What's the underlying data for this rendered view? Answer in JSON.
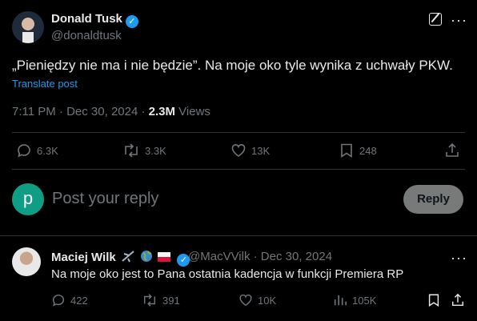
{
  "tweet": {
    "author_name": "Donald Tusk",
    "author_handle": "@donaldtusk",
    "text": "„Pieniędzy nie ma i nie będzie”. Na moje oko tyle wynika z uchwały PKW.",
    "translate_label": "Translate post",
    "time": "7:11 PM · Dec 30, 2024 · ",
    "views_count": "2.3M",
    "views_label": " Views",
    "replies": "6.3K",
    "reposts": "3.3K",
    "likes": "13K",
    "bookmarks": "248"
  },
  "composer": {
    "avatar_letter": "p",
    "placeholder": "Post your reply",
    "reply_button": "Reply"
  },
  "comment": {
    "author_name": "Maciej Wilk",
    "author_handle": "@MacVVilk",
    "date": " · Dec 30, 2024",
    "text": "Na moje oko jest to Pana ostatnia kadencja w funkcji Premiera RP",
    "replies": "422",
    "reposts": "391",
    "likes": "10K",
    "views": "105K"
  },
  "colors": {
    "accent": "#1d9bf0",
    "muted": "#71767b",
    "text": "#e7e9ea",
    "divider": "#2f3336"
  }
}
